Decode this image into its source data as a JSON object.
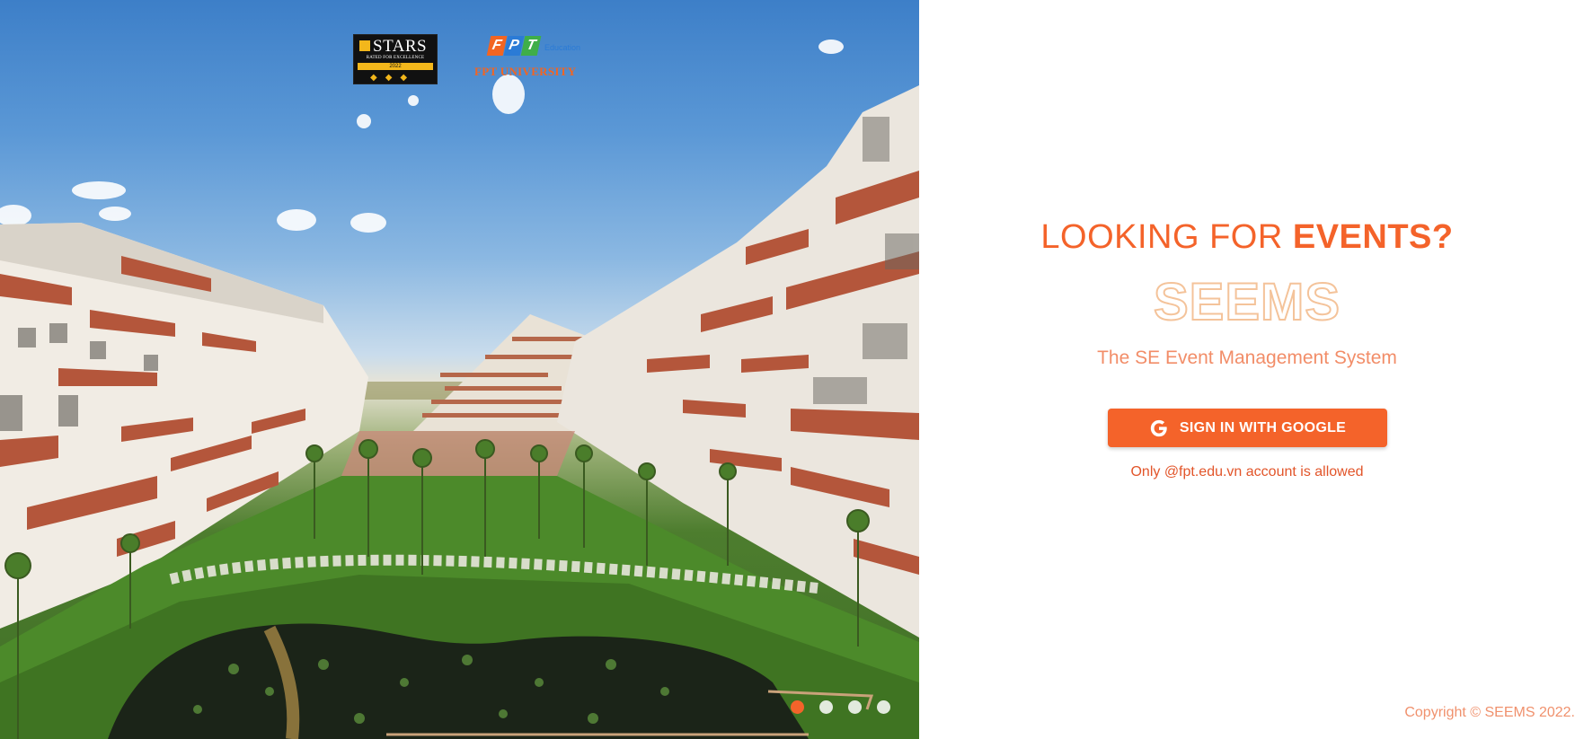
{
  "hero": {
    "stars_badge": {
      "title": "STARS",
      "subtitle": "RATED FOR EXCELLENCE",
      "year": "2022"
    },
    "fpt_logo": {
      "letters": [
        "F",
        "P",
        "T"
      ],
      "letter_colors": [
        "#f26522",
        "#2b7bd6",
        "#3fae49"
      ],
      "education": "Education",
      "university": "FPT UNIVERSITY"
    },
    "carousel": {
      "slide_count": 4,
      "active_index": 0,
      "active_color": "#f4632a"
    }
  },
  "login": {
    "headline_prefix": "LOOKING FOR ",
    "headline_emphasis": "EVENTS?",
    "brand": "SEEMS",
    "tagline": "The SE Event Management System",
    "google_button": {
      "label": "SIGN IN WITH GOOGLE",
      "icon": "google-g-icon"
    },
    "note": "Only @fpt.edu.vn account is allowed",
    "copyright": "Copyright © SEEMS 2022."
  },
  "colors": {
    "accent": "#f4632a",
    "brand_outline": "#f4c39a",
    "tagline": "#f28d68"
  }
}
